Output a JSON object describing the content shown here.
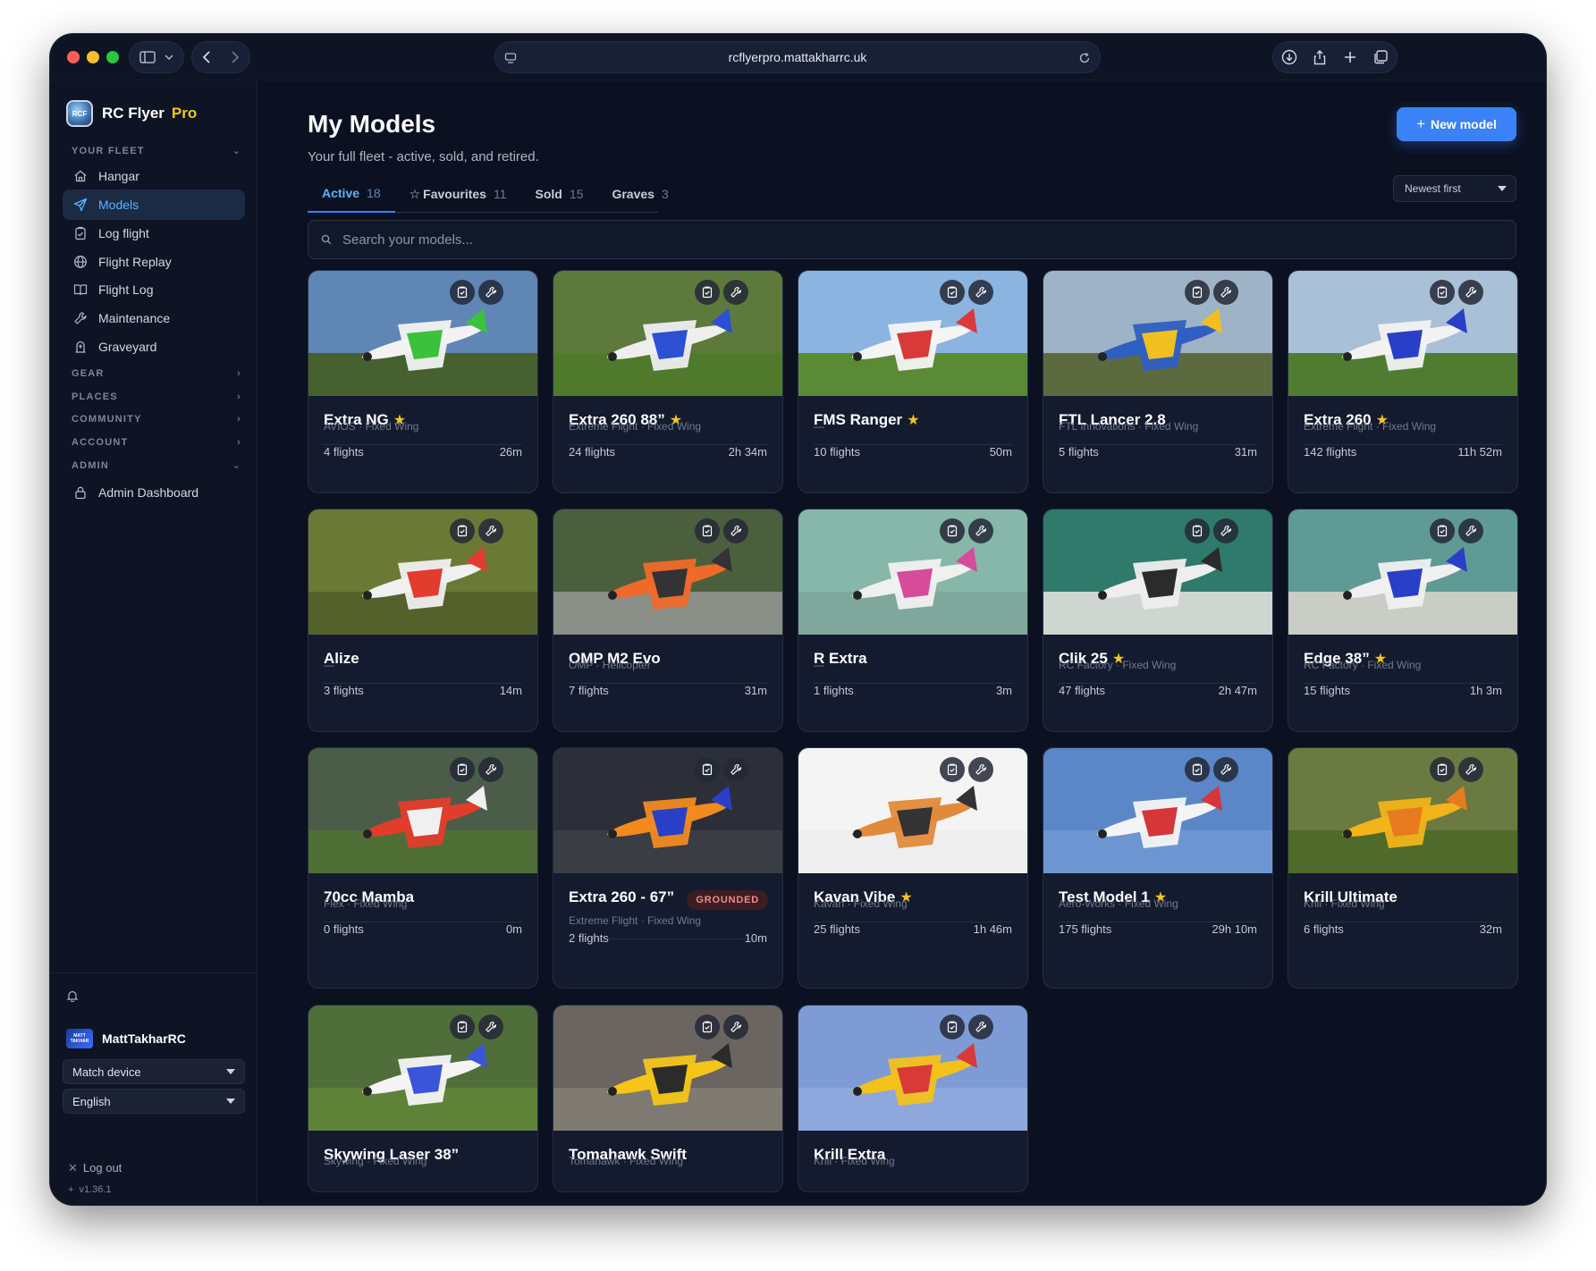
{
  "browser": {
    "url": "rcflyerpro.mattakharrc.uk"
  },
  "brand": {
    "name": "RC Flyer",
    "tier": "Pro",
    "logo_text": "RCF"
  },
  "sidebar": {
    "sections": {
      "fleet": "YOUR FLEET",
      "gear": "GEAR",
      "places": "PLACES",
      "community": "COMMUNITY",
      "account": "ACCOUNT",
      "admin": "ADMIN"
    },
    "items": [
      {
        "label": "Hangar",
        "icon": "home-icon"
      },
      {
        "label": "Models",
        "icon": "paper-plane-icon"
      },
      {
        "label": "Log flight",
        "icon": "clipboard-icon"
      },
      {
        "label": "Flight Replay",
        "icon": "globe-icon"
      },
      {
        "label": "Flight Log",
        "icon": "book-icon"
      },
      {
        "label": "Maintenance",
        "icon": "wrench-icon"
      },
      {
        "label": "Graveyard",
        "icon": "tombstone-icon"
      }
    ],
    "admin_item": {
      "label": "Admin Dashboard",
      "icon": "lock-icon"
    },
    "user": {
      "name": "MattTakharRC",
      "avatar_text": "MATT TAKHAR"
    },
    "theme_select": "Match device",
    "language_select": "English",
    "logout": "Log out",
    "version": "v1.36.1"
  },
  "page": {
    "title": "My Models",
    "subtitle": "Your full fleet - active, sold, and retired.",
    "new_button": "New model",
    "sort": "Newest first",
    "search_placeholder": "Search your models...",
    "tabs": [
      {
        "label": "Active",
        "count": "18"
      },
      {
        "label": "Favourites",
        "count": "11"
      },
      {
        "label": "Sold",
        "count": "15"
      },
      {
        "label": "Graves",
        "count": "3"
      }
    ]
  },
  "colors": {
    "accent": "#3b82f6",
    "brand_pro": "#f5c518",
    "background": "#0b1120",
    "grounded": "#f08a8a"
  },
  "models": [
    {
      "name": "Extra NG",
      "fav": true,
      "meta": "AVIOS · Fixed Wing",
      "flights": "4 flights",
      "time": "26m"
    },
    {
      "name": "Extra 260 88”",
      "fav": true,
      "meta": "Extreme Flight · Fixed Wing",
      "flights": "24 flights",
      "time": "2h 34m"
    },
    {
      "name": "FMS Ranger",
      "fav": true,
      "meta": "—",
      "flights": "10 flights",
      "time": "50m"
    },
    {
      "name": "FTL Lancer 2.8",
      "fav": false,
      "meta": "FTL Innovations · Fixed Wing",
      "flights": "5 flights",
      "time": "31m"
    },
    {
      "name": "Extra 260",
      "fav": true,
      "meta": "Extreme Flight · Fixed Wing",
      "flights": "142 flights",
      "time": "11h 52m"
    },
    {
      "name": "Alize",
      "fav": false,
      "meta": "—",
      "flights": "3 flights",
      "time": "14m"
    },
    {
      "name": "OMP M2 Evo",
      "fav": false,
      "meta": "OMP · Helicopter",
      "flights": "7 flights",
      "time": "31m"
    },
    {
      "name": "R Extra",
      "fav": false,
      "meta": "—",
      "flights": "1 flights",
      "time": "3m"
    },
    {
      "name": "Clik 25",
      "fav": true,
      "meta": "RC Factory · Fixed Wing",
      "flights": "47 flights",
      "time": "2h 47m"
    },
    {
      "name": "Edge 38”",
      "fav": true,
      "meta": "RC Factory · Fixed Wing",
      "flights": "15 flights",
      "time": "1h 3m"
    },
    {
      "name": "70cc Mamba",
      "fav": false,
      "meta": "Flex · Fixed Wing",
      "flights": "0 flights",
      "time": "0m"
    },
    {
      "name": "Extra 260 - 67”",
      "fav": false,
      "grounded": "GROUNDED",
      "meta": "Extreme Flight · Fixed Wing",
      "flights": "2 flights",
      "time": "10m"
    },
    {
      "name": "Kavan Vibe",
      "fav": true,
      "meta": "Kavan · Fixed Wing",
      "flights": "25 flights",
      "time": "1h 46m"
    },
    {
      "name": "Test Model 1",
      "fav": true,
      "meta": "Aero-Works · Fixed Wing",
      "flights": "175 flights",
      "time": "29h 10m"
    },
    {
      "name": "Krill Ultimate",
      "fav": false,
      "meta": "Krill · Fixed Wing",
      "flights": "6 flights",
      "time": "32m"
    },
    {
      "name": "Skywing Laser 38”",
      "fav": false,
      "meta": "Skywing · Fixed Wing",
      "flights": "",
      "time": ""
    },
    {
      "name": "Tomahawk Swift",
      "fav": false,
      "meta": "Tomahawk · Fixed Wing",
      "flights": "",
      "time": ""
    },
    {
      "name": "Krill Extra",
      "fav": false,
      "meta": "Krill · Fixed Wing",
      "flights": "",
      "time": ""
    }
  ]
}
